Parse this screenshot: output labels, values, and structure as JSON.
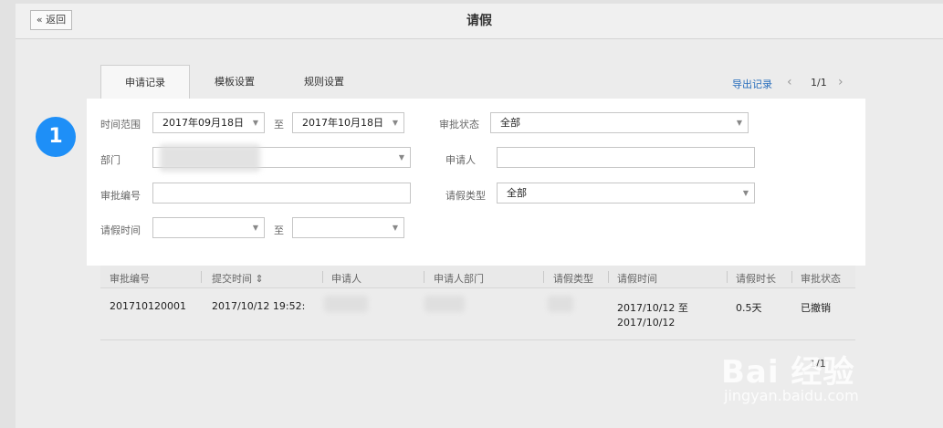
{
  "header": {
    "back_label": "« 返回",
    "title": "请假"
  },
  "tabs": [
    {
      "label": "申请记录",
      "active": true
    },
    {
      "label": "模板设置",
      "active": false
    },
    {
      "label": "规则设置",
      "active": false
    }
  ],
  "toolbar": {
    "export_label": "导出记录",
    "page": "1/1",
    "prev": "‹",
    "next": "›"
  },
  "step_badge": "1",
  "filters": {
    "time_range": {
      "label": "时间范围",
      "start": "2017年09月18日",
      "to": "至",
      "end": "2017年10月18日"
    },
    "approval_status": {
      "label": "审批状态",
      "value": "全部"
    },
    "department": {
      "label": "部门",
      "value": ""
    },
    "applicant": {
      "label": "申请人",
      "value": ""
    },
    "approval_no": {
      "label": "审批编号",
      "value": ""
    },
    "leave_type": {
      "label": "请假类型",
      "value": "全部"
    },
    "leave_time": {
      "label": "请假时间",
      "start": "",
      "to": "至",
      "end": ""
    }
  },
  "table": {
    "columns": [
      "审批编号",
      "提交时间 ⇕",
      "申请人",
      "申请人部门",
      "请假类型",
      "请假时间",
      "请假时长",
      "审批状态"
    ],
    "rows": [
      {
        "approval_no": "201710120001",
        "submit_time": "2017/10/12 19:52:",
        "applicant": "",
        "department": "",
        "leave_type": "",
        "leave_time_line1": "2017/10/12 至",
        "leave_time_line2": "2017/10/12",
        "duration": "0.5天",
        "status": "已撤销"
      }
    ]
  },
  "footer_page": "1/1",
  "watermark": {
    "main": "Bai 经验",
    "sub": "jingyan.baidu.com"
  },
  "colors": {
    "accent": "#1e8ff7",
    "link": "#2a6fbd"
  }
}
